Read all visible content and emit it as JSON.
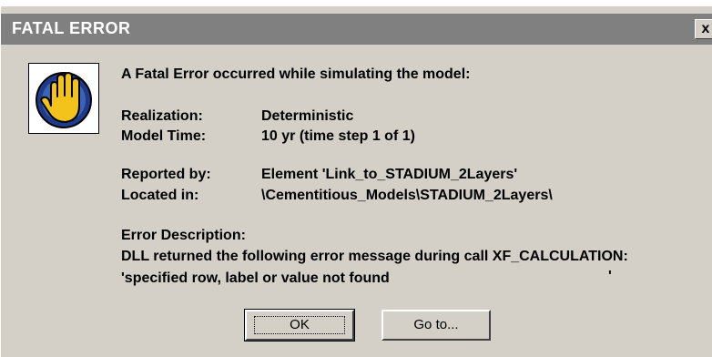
{
  "dialog": {
    "title": "FATAL ERROR",
    "close_glyph": "x",
    "icon": "stop-hand-icon",
    "heading": "A Fatal Error occurred while simulating the model:",
    "realization_label": "Realization:",
    "realization_value": "Deterministic",
    "model_time_label": "Model Time:",
    "model_time_value": "10 yr  (time step 1 of 1)",
    "reported_by_label": "Reported by:",
    "reported_by_value": "Element 'Link_to_STADIUM_2Layers'",
    "located_in_label": "Located in:",
    "located_in_value": "\\Cementitious_Models\\STADIUM_2Layers\\",
    "error_description_label": "Error Description:",
    "error_line1": "DLL returned the following error message during call XF_CALCULATION:",
    "error_line2": "'specified row, label or value not found",
    "error_trailing_quote": "'",
    "buttons": {
      "ok": "OK",
      "goto": "Go to..."
    }
  },
  "colors": {
    "titlebar": "#808080",
    "dialog_bg": "#d4d0c8",
    "icon_circle": "#1f3a8a",
    "icon_hand": "#f3c21b"
  }
}
